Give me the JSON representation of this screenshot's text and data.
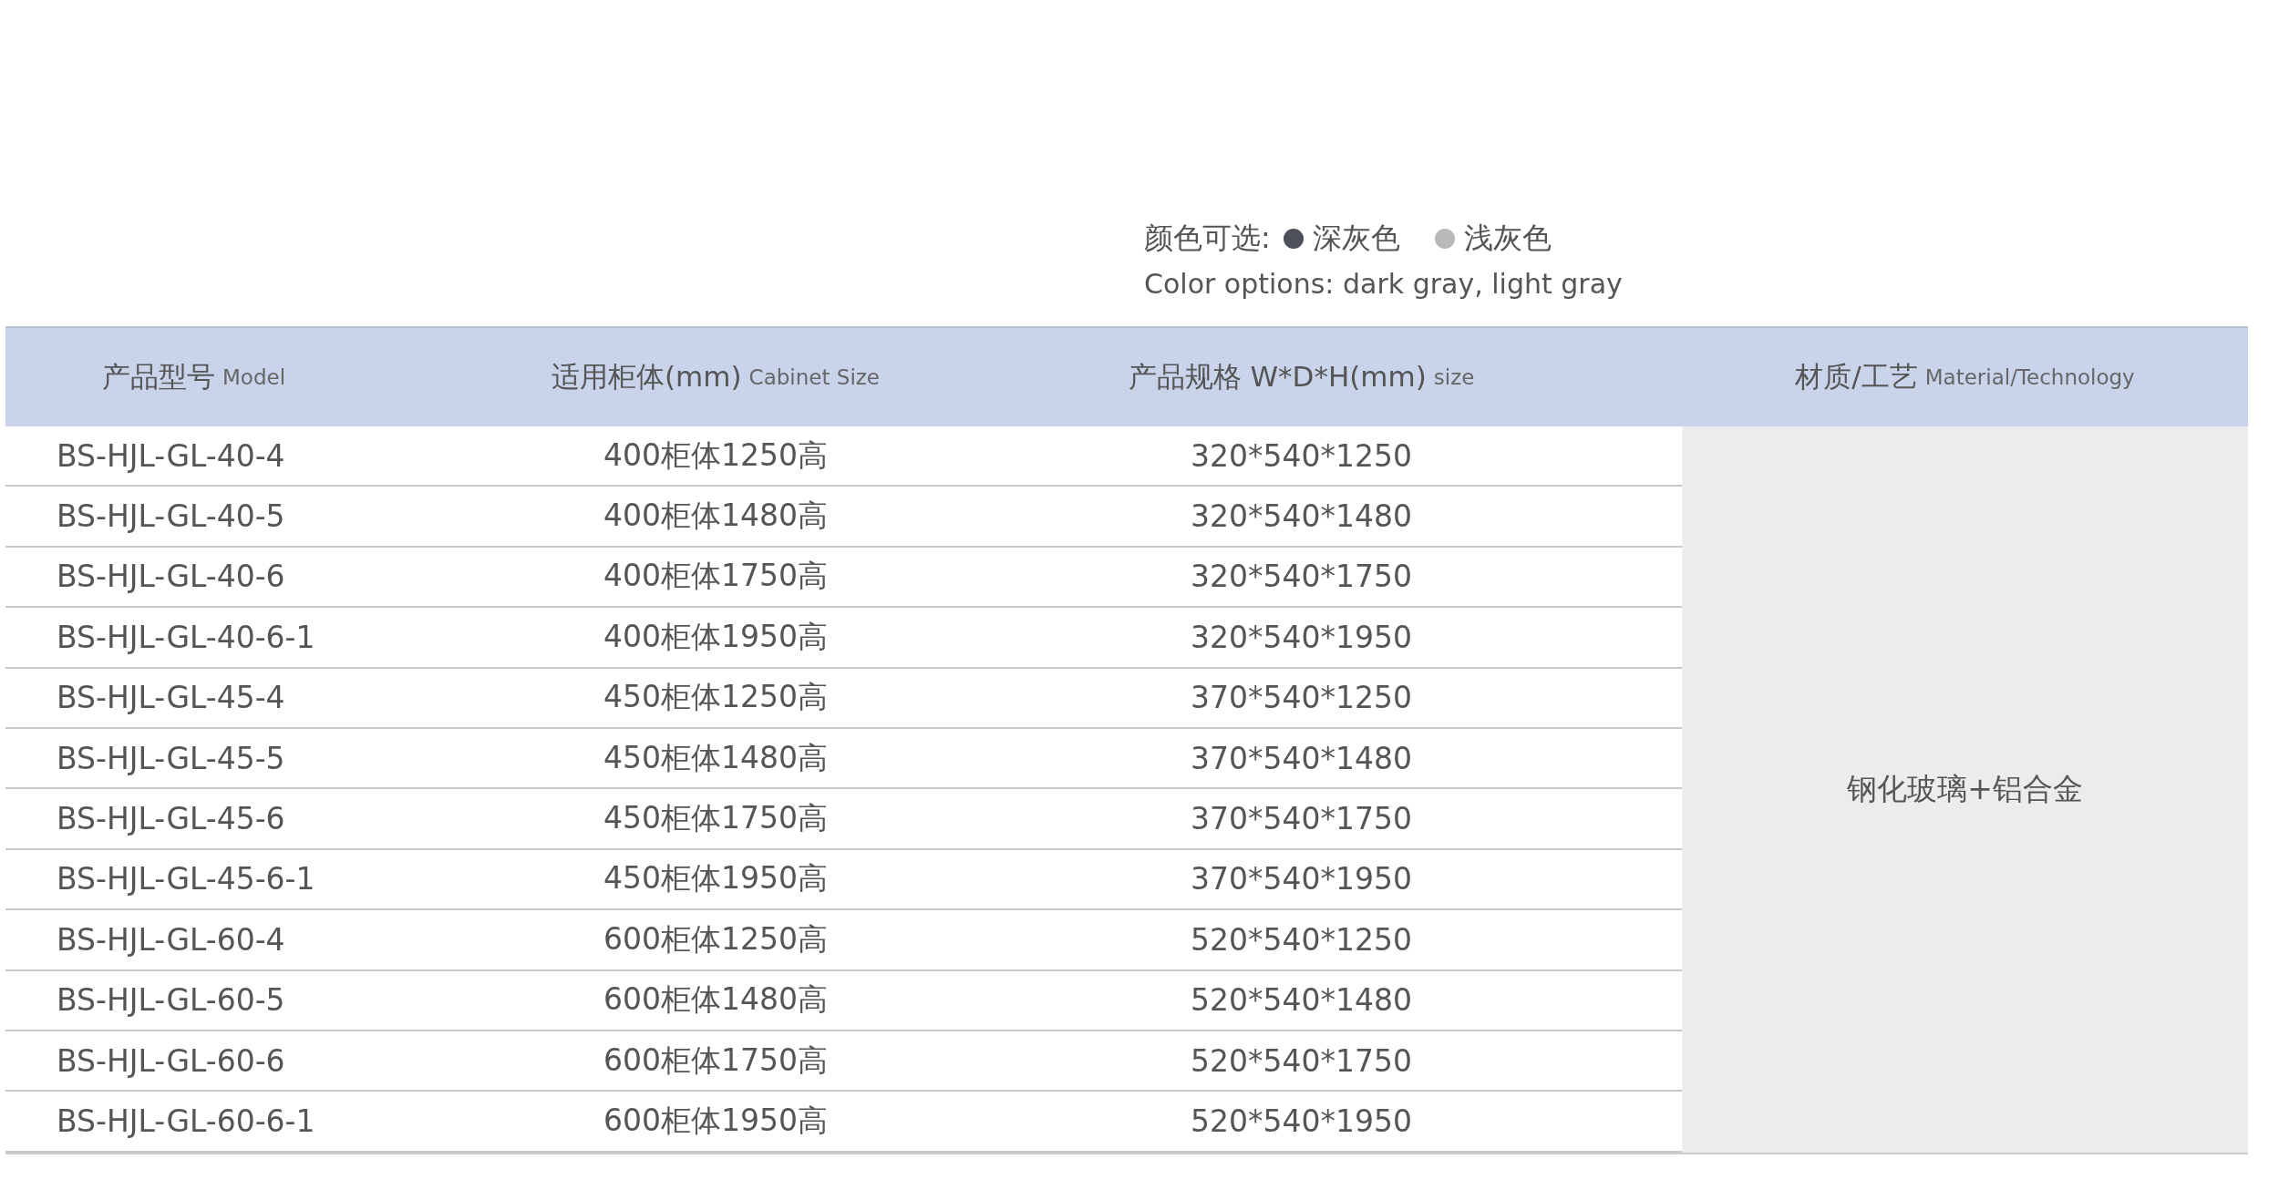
{
  "color_options": {
    "label": "颜色可选:",
    "options": [
      {
        "name": "深灰色",
        "color": "#4d505a"
      },
      {
        "name": "浅灰色",
        "color": "#b9b9b9"
      }
    ],
    "caption": "Color options: dark gray, light gray"
  },
  "table": {
    "columns": [
      {
        "zh": "产品型号",
        "en": "Model"
      },
      {
        "zh": "适用柜体(mm)",
        "en": "Cabinet Size"
      },
      {
        "zh": "产品规格 W*D*H(mm)",
        "en": "size"
      },
      {
        "zh": "材质/工艺",
        "en": "Material/Technology"
      }
    ],
    "rows": [
      [
        "BS-HJL-GL-40-4",
        "400柜体1250高",
        "320*540*1250"
      ],
      [
        "BS-HJL-GL-40-5",
        "400柜体1480高",
        "320*540*1480"
      ],
      [
        "BS-HJL-GL-40-6",
        "400柜体1750高",
        "320*540*1750"
      ],
      [
        "BS-HJL-GL-40-6-1",
        "400柜体1950高",
        "320*540*1950"
      ],
      [
        "BS-HJL-GL-45-4",
        "450柜体1250高",
        "370*540*1250"
      ],
      [
        "BS-HJL-GL-45-5",
        "450柜体1480高",
        "370*540*1480"
      ],
      [
        "BS-HJL-GL-45-6",
        "450柜体1750高",
        "370*540*1750"
      ],
      [
        "BS-HJL-GL-45-6-1",
        "450柜体1950高",
        "370*540*1950"
      ],
      [
        "BS-HJL-GL-60-4",
        "600柜体1250高",
        "520*540*1250"
      ],
      [
        "BS-HJL-GL-60-5",
        "600柜体1480高",
        "520*540*1480"
      ],
      [
        "BS-HJL-GL-60-6",
        "600柜体1750高",
        "520*540*1750"
      ],
      [
        "BS-HJL-GL-60-6-1",
        "600柜体1950高",
        "520*540*1950"
      ]
    ],
    "material": "钢化玻璃+铝合金"
  }
}
